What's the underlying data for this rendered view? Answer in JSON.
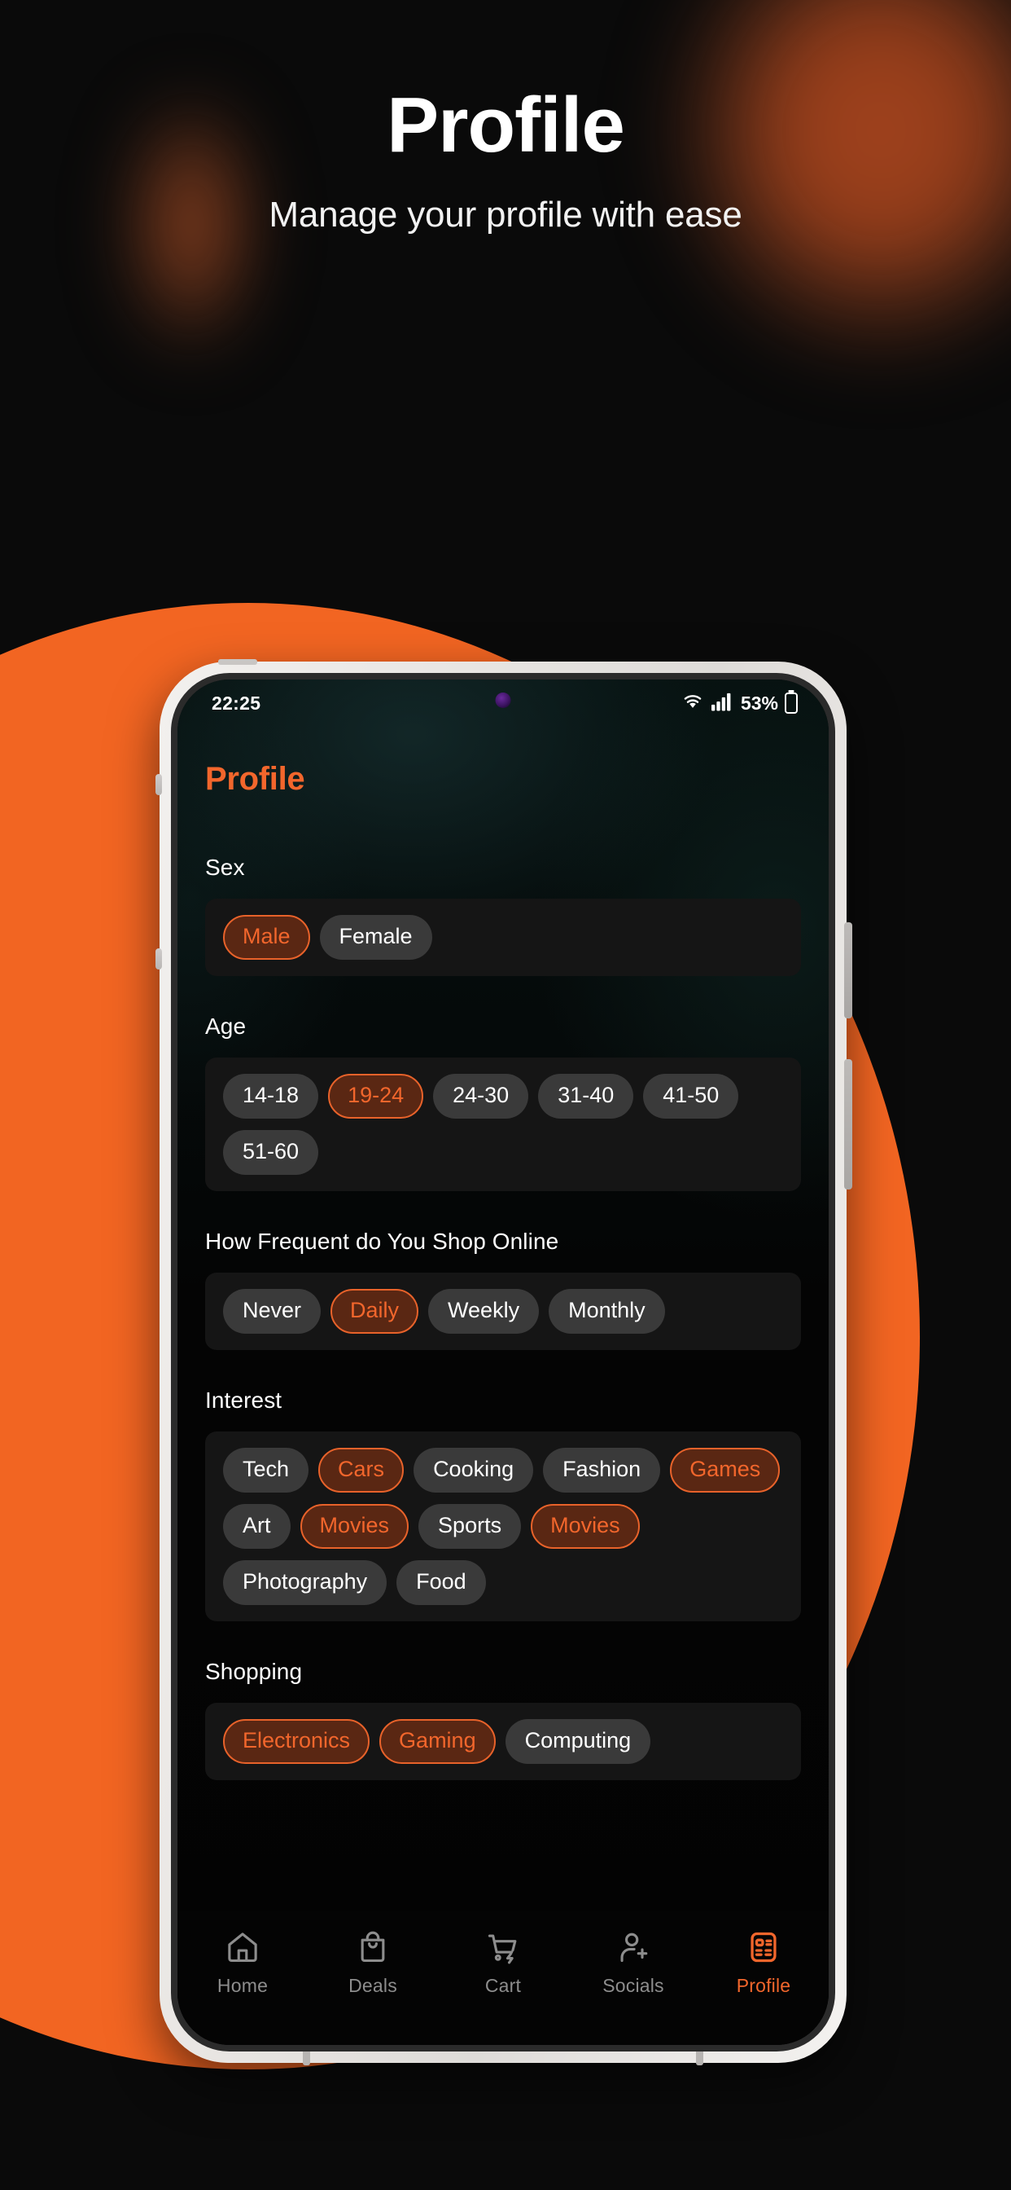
{
  "promo": {
    "title": "Profile",
    "subtitle": "Manage your profile with ease"
  },
  "colors": {
    "accent": "#F2662C",
    "accent_border": "#E8622A",
    "chip_selected_bg": "#5A2713",
    "chip_unselected_bg": "#3A3A3A",
    "card_bg": "#151515",
    "promo_bg": "#0A0A0A",
    "circle": "#F26522",
    "screen_bg": "#040404"
  },
  "status_bar": {
    "time": "22:25",
    "battery_percent": "53%",
    "wifi_icon": "wifi-icon",
    "signal_icon": "signal-bars-icon",
    "battery_icon": "battery-icon",
    "camera_icon": "front-camera-punch-hole"
  },
  "app": {
    "title": "Profile",
    "sections": [
      {
        "label": "Sex",
        "chips": [
          {
            "label": "Male",
            "selected": true
          },
          {
            "label": "Female",
            "selected": false
          }
        ]
      },
      {
        "label": "Age",
        "chips": [
          {
            "label": "14-18",
            "selected": false
          },
          {
            "label": "19-24",
            "selected": true
          },
          {
            "label": "24-30",
            "selected": false
          },
          {
            "label": "31-40",
            "selected": false
          },
          {
            "label": "41-50",
            "selected": false
          },
          {
            "label": "51-60",
            "selected": false
          }
        ]
      },
      {
        "label": "How Frequent do You Shop Online",
        "chips": [
          {
            "label": "Never",
            "selected": false
          },
          {
            "label": "Daily",
            "selected": true
          },
          {
            "label": "Weekly",
            "selected": false
          },
          {
            "label": "Monthly",
            "selected": false
          }
        ]
      },
      {
        "label": "Interest",
        "chips": [
          {
            "label": "Tech",
            "selected": false
          },
          {
            "label": "Cars",
            "selected": true
          },
          {
            "label": "Cooking",
            "selected": false
          },
          {
            "label": "Fashion",
            "selected": false
          },
          {
            "label": "Games",
            "selected": true
          },
          {
            "label": "Art",
            "selected": false
          },
          {
            "label": "Movies",
            "selected": true
          },
          {
            "label": "Sports",
            "selected": false
          },
          {
            "label": "Movies",
            "selected": true
          },
          {
            "label": "Photography",
            "selected": false
          },
          {
            "label": "Food",
            "selected": false
          }
        ]
      },
      {
        "label": "Shopping",
        "chips": [
          {
            "label": "Electronics",
            "selected": true
          },
          {
            "label": "Gaming",
            "selected": true
          },
          {
            "label": "Computing",
            "selected": false
          }
        ]
      }
    ]
  },
  "bottom_nav": {
    "items": [
      {
        "label": "Home",
        "icon": "home-icon",
        "active": false
      },
      {
        "label": "Deals",
        "icon": "bag-icon",
        "active": false
      },
      {
        "label": "Cart",
        "icon": "cart-icon",
        "active": false
      },
      {
        "label": "Socials",
        "icon": "person-add-icon",
        "active": false
      },
      {
        "label": "Profile",
        "icon": "id-card-icon",
        "active": true
      }
    ]
  }
}
